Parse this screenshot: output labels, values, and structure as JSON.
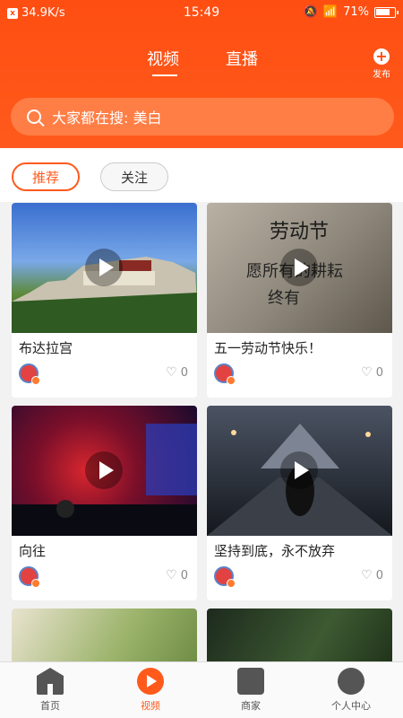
{
  "status": {
    "speed": "34.9K/s",
    "time": "15:49",
    "battery": "71%"
  },
  "tabs": {
    "video": "视频",
    "live": "直播",
    "publish": "发布"
  },
  "search": {
    "placeholder": "大家都在搜: 美白"
  },
  "filters": {
    "recommend": "推荐",
    "follow": "关注"
  },
  "cards": [
    {
      "title": "布达拉宫",
      "likes": "0"
    },
    {
      "title": "五一劳动节快乐！",
      "likes": "0"
    },
    {
      "title": "向往",
      "likes": "0"
    },
    {
      "title": "坚持到底，永不放弃",
      "likes": "0"
    }
  ],
  "thumb_art": {
    "labor_title": "劳动节",
    "labor_line1": "愿所有的耕耘",
    "labor_line2": "终有"
  },
  "nav": {
    "home": "首页",
    "video": "视频",
    "shop": "商家",
    "me": "个人中心"
  },
  "colors": {
    "brand": "#ff5a1c",
    "text": "#222222",
    "muted": "#888888"
  }
}
